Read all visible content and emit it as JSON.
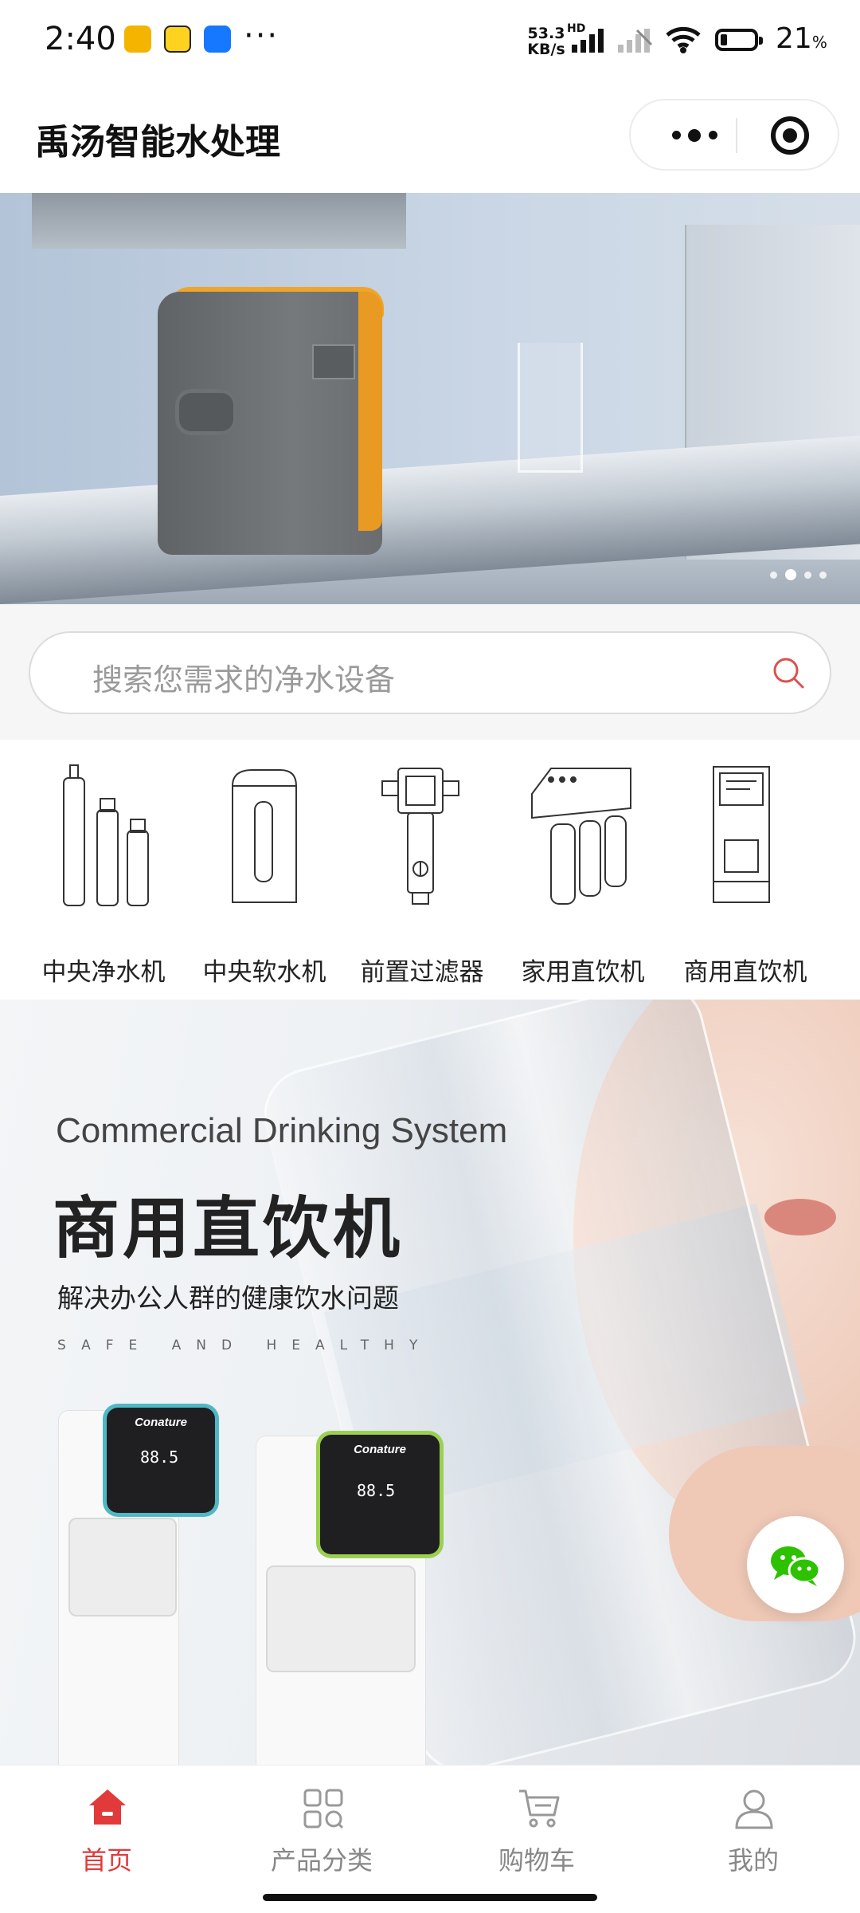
{
  "status_bar": {
    "time": "2:40",
    "more": "···",
    "speed": "53.3 KB/s",
    "hd": "HD",
    "battery_pct": "21",
    "battery_unit": "%",
    "battery_level": 0.21
  },
  "header": {
    "title": "禹汤智能水处理"
  },
  "banner": {
    "slide_count": 4,
    "active_slide": 2
  },
  "search": {
    "placeholder": "搜索您需求的净水设备"
  },
  "categories": [
    {
      "label": "中央净水机",
      "icon": "central-purifier-icon"
    },
    {
      "label": "中央软水机",
      "icon": "water-softener-icon"
    },
    {
      "label": "前置过滤器",
      "icon": "prefilter-icon"
    },
    {
      "label": "家用直饮机",
      "icon": "home-drinking-machine-icon"
    },
    {
      "label": "商用直饮机",
      "icon": "commercial-drinking-machine-icon"
    }
  ],
  "promo": {
    "subtitle": "Commercial Drinking System",
    "title": "商用直饮机",
    "description": "解决办公人群的健康饮水问题",
    "tagline": "SAFE AND HEALTHY",
    "brand": "Conature",
    "digits": "88.5"
  },
  "tabbar": {
    "items": [
      {
        "label": "首页",
        "icon": "home-icon",
        "active": true
      },
      {
        "label": "产品分类",
        "icon": "category-grid-icon",
        "active": false
      },
      {
        "label": "购物车",
        "icon": "cart-icon",
        "active": false
      },
      {
        "label": "我的",
        "icon": "user-icon",
        "active": false
      }
    ]
  },
  "colors": {
    "accent": "#e23a3a",
    "inactive_tab": "#888888"
  }
}
